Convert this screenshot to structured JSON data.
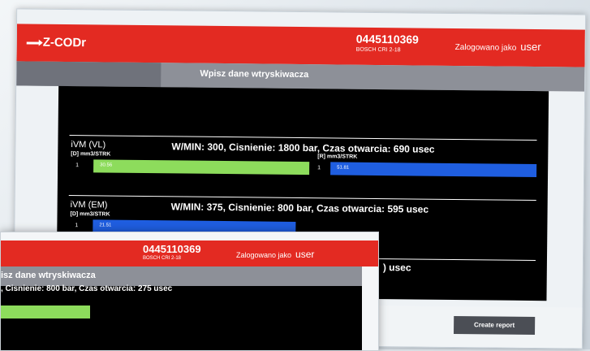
{
  "app": {
    "logo_text": "Z-CODr"
  },
  "header": {
    "part_number": "0445110369",
    "part_variant": "BOSCH CRI 2-18",
    "login_label": "Zalogowano jako",
    "user": "user"
  },
  "subheader": {
    "title": "Wpisz dane wtryskiwacza"
  },
  "sections": [
    {
      "name": "iVM (VL)",
      "info": "W/MIN: 300, Cisnienie: 1800 bar, Czas otwarcia: 690 usec",
      "unit_d": "[D] mm3/STRK",
      "unit_r": "[R] mm3/STRK",
      "cyl": "1",
      "cyl_r": "1",
      "bar_d_value": "30.56",
      "bar_r_value": "51.81"
    },
    {
      "name": "iVM (EM)",
      "info": "W/MIN: 375, Cisnienie: 800 bar, Czas otwarcia: 595 usec",
      "unit_d": "[D] mm3/STRK",
      "cyl": "1",
      "bar_d_value": "21.51"
    },
    {
      "info_tail": ") usec"
    }
  ],
  "actions": {
    "create_report": "Create report"
  },
  "inset": {
    "part_number": "0445110369",
    "part_variant": "BOSCH CRI 2-18",
    "login_label": "Zalogowano jako",
    "user": "user",
    "subheader": "isz dane wtryskiwacza",
    "info": ", Cisnienie: 800 bar, Czas otwarcia: 275 usec"
  },
  "colors": {
    "header_red": "#e32a22",
    "bar_green": "#8ddc5c",
    "bar_blue": "#1f5ee0",
    "subheader_gray": "#8d9098"
  }
}
